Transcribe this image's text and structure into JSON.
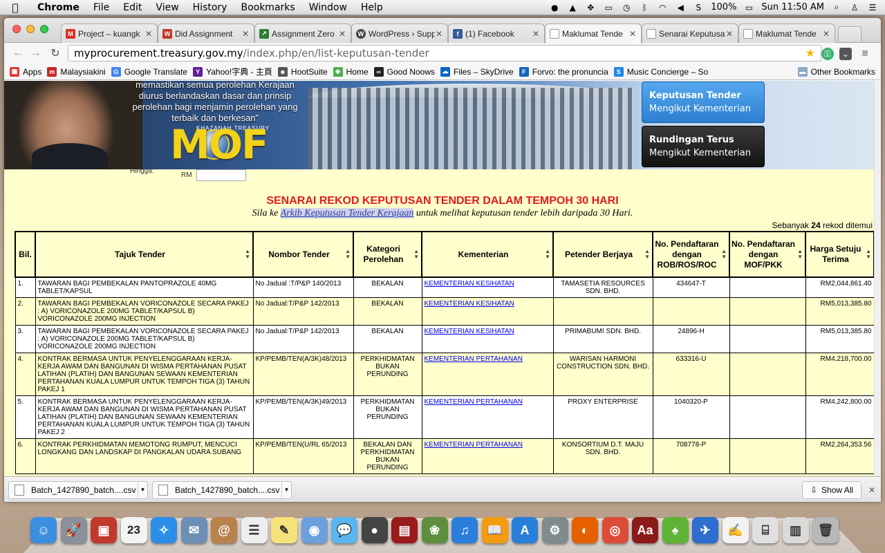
{
  "menubar": {
    "app_name": "Chrome",
    "menus": [
      "File",
      "Edit",
      "View",
      "History",
      "Bookmarks",
      "Window",
      "Help"
    ],
    "battery": "100%",
    "clock": "Sun 11:50 AM"
  },
  "tabs": [
    {
      "title": "Project – kuangk",
      "favicon_color": "#d93025",
      "favicon_text": "M"
    },
    {
      "title": "Did Assignment",
      "favicon_color": "#c0392b",
      "favicon_text": "W"
    },
    {
      "title": "Assignment Zero",
      "favicon_color": "#2e7d32",
      "favicon_text": "↗"
    },
    {
      "title": "WordPress › Supp",
      "favicon_color": "#464646",
      "favicon_text": "W"
    },
    {
      "title": "(1) Facebook",
      "favicon_color": "#3b5998",
      "favicon_text": "f"
    },
    {
      "title": "Maklumat Tende",
      "favicon_color": "#ffffff",
      "favicon_text": ""
    },
    {
      "title": "Senarai Keputusa",
      "favicon_color": "#ffffff",
      "favicon_text": ""
    },
    {
      "title": "Maklumat Tende",
      "favicon_color": "#ffffff",
      "favicon_text": ""
    }
  ],
  "omnibox": {
    "host": "myprocurement.treasury.gov.my",
    "path": "/index.php/en/list-keputusan-tender"
  },
  "bookmarks": [
    {
      "label": "Apps",
      "color": "#e53935"
    },
    {
      "label": "Malaysiakini",
      "color": "#c62828"
    },
    {
      "label": "Google Translate",
      "color": "#4285f4"
    },
    {
      "label": "Yahoo!字典 - 主頁",
      "color": "#5c1f99"
    },
    {
      "label": "HootSuite",
      "color": "#555555"
    },
    {
      "label": "Home",
      "color": "#4caf50"
    },
    {
      "label": "Good Noows",
      "color": "#222222"
    },
    {
      "label": "Files – SkyDrive",
      "color": "#0a66c2"
    },
    {
      "label": "Forvo: the pronuncia",
      "color": "#1565c0"
    },
    {
      "label": "Music Concierge – So",
      "color": "#1e88e5"
    }
  ],
  "other_bookmarks": "Other Bookmarks",
  "banner": {
    "quote": "memastikan semua perolehan Kerajaan diurus berlandaskan dasar dan prinsip perolehan bagi menjamin perolehan yang terbaik dan berkesan”",
    "logo": "MOF",
    "logo_arc": "KHAZANAH TREASURY",
    "button1_line1": "Keputusan Tender",
    "button1_line2": "Mengikut Kementerian",
    "button2_line1": "Rundingan Terus",
    "button2_line2": "Mengikut Kementerian"
  },
  "form_stub": {
    "hingga": "Hingga:",
    "rm": "RM"
  },
  "page": {
    "heading": "SENARAI REKOD KEPUTUSAN TENDER DALAM TEMPOH 30 HARI",
    "sub_before": "Sila ke ",
    "sub_link": "Arkib Keputusan Tender Kerajaan",
    "sub_after": " untuk melihat keputusan tender lebih daripada 30 Hari.",
    "count_before": "Sebanyak ",
    "count_value": "24",
    "count_after": " rekod ditemui"
  },
  "table": {
    "headers": [
      "Bil.",
      "Tajuk Tender",
      "Nombor Tender",
      "Kategori Perolehan",
      "Kementerian",
      "Petender Berjaya",
      "No. Pendaftaran dengan ROB/ROS/ROC",
      "No. Pendaftaran dengan MOF/PKK",
      "Harga Setuju Terima"
    ],
    "rows": [
      {
        "bil": "1.",
        "tajuk": "TAWARAN BAGI PEMBEKALAN PANTOPRAZOLE 40MG TABLET/KAPSUL",
        "nombor": "No Jadual :T/P&P 140/2013",
        "kategori": "BEKALAN",
        "kementerian": "KEMENTERIAN KESIHATAN",
        "petender": "TAMASETIA RESOURCES SDN. BHD.",
        "rob": "434647-T",
        "mof": "",
        "harga": "RM2,044,861.40"
      },
      {
        "bil": "2.",
        "tajuk": "TAWARAN BAGI PEMBEKALAN VORICONAZOLE SECARA PAKEJ : A) VORICONAZOLE 200MG TABLET/KAPSUL B) VORICONAZOLE 200MG INJECTION",
        "nombor": "No Jadual:T/P&P 142/2013",
        "kategori": "BEKALAN",
        "kementerian": "KEMENTERIAN KESIHATAN",
        "petender": "",
        "rob": "",
        "mof": "",
        "harga": "RM5,013,385.80"
      },
      {
        "bil": "3.",
        "tajuk": "TAWARAN BAGI PEMBEKALAN VORICONAZOLE SECARA PAKEJ : A) VORICONAZOLE 200MG TABLET/KAPSUL B) VORICONAZOLE 200MG INJECTION",
        "nombor": "No Jadual:T/P&P 142/2013",
        "kategori": "BEKALAN",
        "kementerian": "KEMENTERIAN KESIHATAN",
        "petender": "PRIMABUMI SDN. BHD.",
        "rob": "24896-H",
        "mof": "",
        "harga": "RM5,013,385.80"
      },
      {
        "bil": "4.",
        "tajuk": "KONTRAK BERMASA UNTUK PENYELENGGARAAN KERJA-KERJA AWAM DAN BANGUNAN DI WISMA PERTAHANAN PUSAT LATIHAN (PLATIH) DAN BANGUNAN SEWAAN KEMENTERIAN PERTAHANAN KUALA LUMPUR UNTUK TEMPOH TIGA (3) TAHUN PAKEJ 1",
        "nombor": "KP/PEMB/TEN(A/3K)48/2013",
        "kategori": "PERKHIDMATAN BUKAN PERUNDING",
        "kementerian": "KEMENTERIAN PERTAHANAN",
        "petender": "WARISAN HARMONI CONSTRUCTION SDN. BHD.",
        "rob": "633316-U",
        "mof": "",
        "harga": "RM4,218,700.00"
      },
      {
        "bil": "5.",
        "tajuk": "KONTRAK BERMASA UNTUK PENYELENGGARAAN KERJA-KERJA AWAM DAN BANGUNAN DI WISMA PERTAHANAN PUSAT LATIHAN (PLATIH) DAN BANGUNAN SEWAAN KEMENTERIAN PERTAHANAN KUALA LUMPUR UNTUK TEMPOH TIGA (3) TAHUN PAKEJ 2",
        "nombor": "KP/PEMB/TEN(A/3K)49/2013",
        "kategori": "PERKHIDMATAN BUKAN PERUNDING",
        "kementerian": "KEMENTERIAN PERTAHANAN",
        "petender": "PROXY ENTERPRISE",
        "rob": "1040320-P",
        "mof": "",
        "harga": "RM4,242,800.00"
      },
      {
        "bil": "6.",
        "tajuk": "KONTRAK PERKHIDMATAN MEMOTONG RUMPUT, MENCUCI LONGKANG DAN LANDSKAP DI PANGKALAN UDARA SUBANG",
        "nombor": "KP/PEMB/TEN(U/RL 65/2013",
        "kategori": "BEKALAN DAN PERKHIDMATAN BUKAN PERUNDING",
        "kementerian": "KEMENTERIAN PERTAHANAN",
        "petender": "KONSORTIUM D.T. MAJU SDN. BHD.",
        "rob": "708778-P",
        "mof": "",
        "harga": "RM2,264,353.56"
      }
    ]
  },
  "downloads": {
    "items": [
      "Batch_1427890_batch....csv",
      "Batch_1427890_batch....csv"
    ],
    "show_all": "Show All"
  },
  "dock": {
    "calendar_day": "23",
    "icons": [
      {
        "name": "finder-icon",
        "color": "#3b8fe0",
        "glyph": "☺"
      },
      {
        "name": "launchpad-icon",
        "color": "#8a8f99",
        "glyph": "🚀"
      },
      {
        "name": "photo-booth-icon",
        "color": "#c0392b",
        "glyph": "▣"
      },
      {
        "name": "calendar-icon",
        "color": "#f4f4f4",
        "glyph": ""
      },
      {
        "name": "safari-icon",
        "color": "#2b8fe8",
        "glyph": "✧"
      },
      {
        "name": "mail-icon",
        "color": "#6d8fb5",
        "glyph": "✉"
      },
      {
        "name": "contacts-icon",
        "color": "#b9824c",
        "glyph": "@"
      },
      {
        "name": "reminders-icon",
        "color": "#eeeeee",
        "glyph": "☰"
      },
      {
        "name": "notes-icon",
        "color": "#f6e27a",
        "glyph": "✎"
      },
      {
        "name": "preview-icon",
        "color": "#6ca0dc",
        "glyph": "◉"
      },
      {
        "name": "messages-icon",
        "color": "#5ab6f0",
        "glyph": "💬"
      },
      {
        "name": "facetime-icon",
        "color": "#444444",
        "glyph": "●"
      },
      {
        "name": "photobooth-icon",
        "color": "#9a1b1b",
        "glyph": "▤"
      },
      {
        "name": "iphoto-icon",
        "color": "#5f8f3e",
        "glyph": "❀"
      },
      {
        "name": "itunes-icon",
        "color": "#2a7fdc",
        "glyph": "♫"
      },
      {
        "name": "ibooks-icon",
        "color": "#f39c12",
        "glyph": "📖"
      },
      {
        "name": "app-store-icon",
        "color": "#2980d9",
        "glyph": "A"
      },
      {
        "name": "system-preferences-icon",
        "color": "#7f8c8d",
        "glyph": "⚙"
      },
      {
        "name": "firefox-icon",
        "color": "#e66000",
        "glyph": "◐"
      },
      {
        "name": "chrome-icon",
        "color": "#dd4b39",
        "glyph": "◎"
      },
      {
        "name": "dictionary-icon",
        "color": "#8b1a1a",
        "glyph": "Aa"
      },
      {
        "name": "evernote-icon",
        "color": "#5fb336",
        "glyph": "♠"
      },
      {
        "name": "openoffice-icon",
        "color": "#2d6ecf",
        "glyph": "✈"
      },
      {
        "name": "textedit-icon",
        "color": "#f3f3f3",
        "glyph": "✍"
      },
      {
        "name": "downloads-stack-icon",
        "color": "#e0e0e0",
        "glyph": "⌸"
      },
      {
        "name": "documents-stack-icon",
        "color": "#d9d9d9",
        "glyph": "▥"
      },
      {
        "name": "trash-icon",
        "color": "#b8b8b8",
        "glyph": "🗑"
      }
    ]
  }
}
